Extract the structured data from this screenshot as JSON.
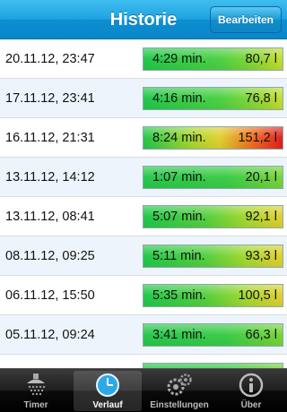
{
  "navbar": {
    "title": "Historie",
    "edit_label": "Bearbeiten"
  },
  "history": [
    {
      "date": "20.11.12, 23:47",
      "duration": "4:29 min.",
      "volume": "80,7 l",
      "level": 0.53
    },
    {
      "date": "17.11.12, 23:41",
      "duration": "4:16 min.",
      "volume": "76,8 l",
      "level": 0.51
    },
    {
      "date": "16.11.12, 21:31",
      "duration": "8:24 min.",
      "volume": "151,2 l",
      "level": 1.0
    },
    {
      "date": "13.11.12, 14:12",
      "duration": "1:07 min.",
      "volume": "20,1 l",
      "level": 0.13
    },
    {
      "date": "13.11.12, 08:41",
      "duration": "5:07 min.",
      "volume": "92,1 l",
      "level": 0.61
    },
    {
      "date": "08.11.12, 09:25",
      "duration": "5:11 min.",
      "volume": "93,3 l",
      "level": 0.62
    },
    {
      "date": "06.11.12, 15:50",
      "duration": "5:35 min.",
      "volume": "100,5 l",
      "level": 0.66
    },
    {
      "date": "05.11.12, 09:24",
      "duration": "3:41 min.",
      "volume": "66,3 l",
      "level": 0.44
    },
    {
      "date": "",
      "duration": "",
      "volume": "",
      "level": 0.4
    }
  ],
  "tabs": [
    {
      "label": "Timer",
      "icon": "shower-icon",
      "active": false
    },
    {
      "label": "Verlauf",
      "icon": "clock-icon",
      "active": true
    },
    {
      "label": "Einstellungen",
      "icon": "gears-icon",
      "active": false
    },
    {
      "label": "Über",
      "icon": "info-icon",
      "active": false
    }
  ],
  "colors": {
    "accent": "#1fa3e0",
    "green": "#22c84a",
    "yellow": "#e0d030",
    "red": "#e02020"
  }
}
